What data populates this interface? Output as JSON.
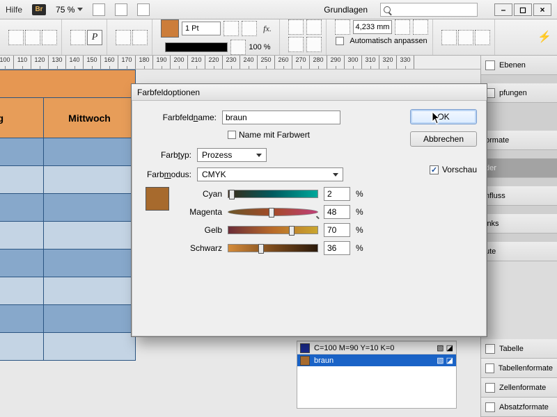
{
  "menubar": {
    "help": "Hilfe",
    "br": "Br",
    "zoom": "75 %",
    "grundlagen": "Grundlagen"
  },
  "winbtns": {
    "min": "–",
    "max": "◻",
    "close": "×"
  },
  "toolbar2": {
    "stroke_weight": "1 Pt",
    "stroke_percent": "100 %",
    "mm_value": "4,233 mm",
    "auto_fit": "Automatisch anpassen"
  },
  "ruler_values": [
    "100",
    "110",
    "120",
    "130",
    "140",
    "150",
    "160",
    "170",
    "180",
    "190",
    "200",
    "210",
    "220",
    "230",
    "240",
    "250",
    "260",
    "270",
    "280",
    "290",
    "300",
    "310",
    "320",
    "330"
  ],
  "calendar": {
    "headers": [
      "ng",
      "Mittwoch"
    ]
  },
  "rightpanels": {
    "p0": "Ebenen",
    "p1": "pfungen",
    "p2": "ormate",
    "p3": "der",
    "p4": "nfluss",
    "p5": "inks",
    "p6": "ute",
    "b0": "Tabelle",
    "b1": "Tabellenformate",
    "b2": "Zellenformate",
    "b3": "Absatzformate"
  },
  "swatchlist": {
    "row1": "C=100 M=90 Y=10 K=0",
    "row2": "braun"
  },
  "dialog": {
    "title": "Farbfeldoptionen",
    "name_label_pre": "Farbfeld",
    "name_label_ul": "n",
    "name_label_post": "ame:",
    "name_value": "braun",
    "name_with_value": "Name mit Farbwert",
    "type_label_pre": "Farb",
    "type_label_ul": "t",
    "type_label_post": "yp:",
    "type_value": "Prozess",
    "mode_label_pre": "Farb",
    "mode_label_ul": "m",
    "mode_label_post": "odus:",
    "mode_value": "CMYK",
    "cyan_label": "Cyan",
    "magenta_label": "Magenta",
    "yellow_label": "Gelb",
    "black_label": "Schwarz",
    "cyan": "2",
    "magenta": "48",
    "yellow": "70",
    "black": "36",
    "percent": "%",
    "ok": "OK",
    "cancel": "Abbrechen",
    "preview": "Vorschau",
    "check": "✓"
  }
}
